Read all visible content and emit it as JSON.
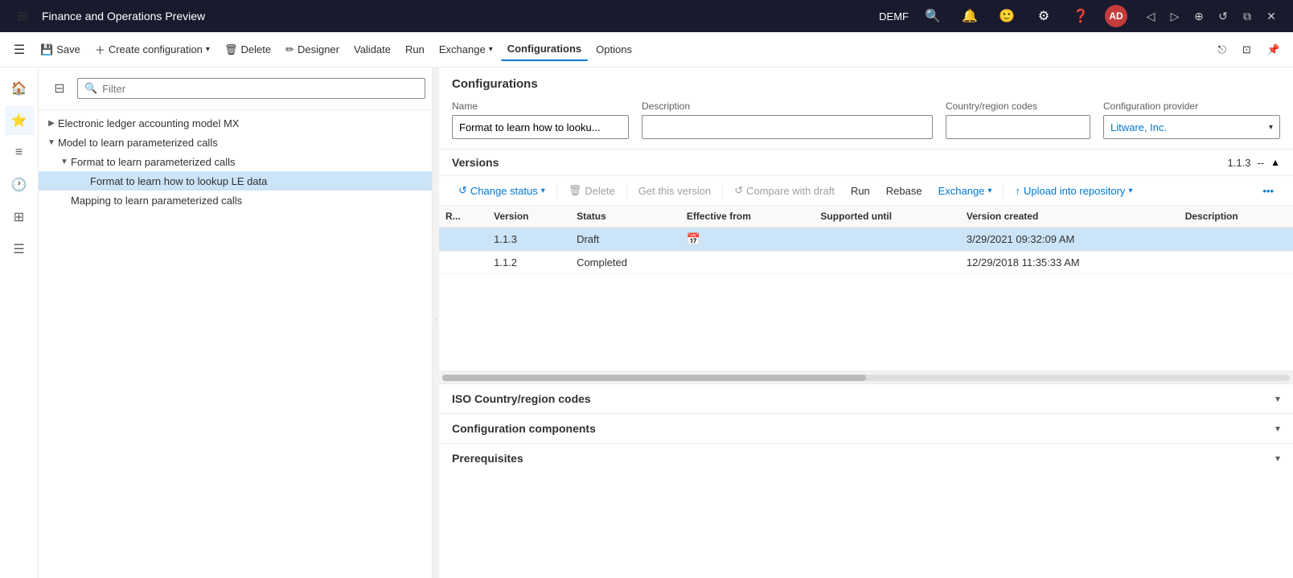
{
  "titlebar": {
    "title": "Finance and Operations Preview",
    "user_label": "DEMF",
    "avatar_initials": "AD"
  },
  "commandbar": {
    "save_label": "Save",
    "create_config_label": "Create configuration",
    "delete_label": "Delete",
    "designer_label": "Designer",
    "validate_label": "Validate",
    "run_label": "Run",
    "exchange_label": "Exchange",
    "configurations_label": "Configurations",
    "options_label": "Options"
  },
  "tree": {
    "filter_placeholder": "Filter",
    "items": [
      {
        "id": "item1",
        "label": "Electronic ledger accounting model MX",
        "indent": 1,
        "expand": "right",
        "selected": false
      },
      {
        "id": "item2",
        "label": "Model to learn parameterized calls",
        "indent": 1,
        "expand": "down",
        "selected": false
      },
      {
        "id": "item3",
        "label": "Format to learn parameterized calls",
        "indent": 2,
        "expand": "down",
        "selected": false
      },
      {
        "id": "item4",
        "label": "Format to learn how to lookup LE data",
        "indent": 3,
        "expand": null,
        "selected": true
      },
      {
        "id": "item5",
        "label": "Mapping to learn parameterized calls",
        "indent": 2,
        "expand": null,
        "selected": false
      }
    ]
  },
  "configurations": {
    "section_title": "Configurations",
    "name_label": "Name",
    "name_value": "Format to learn how to looku...",
    "description_label": "Description",
    "description_value": "",
    "country_label": "Country/region codes",
    "country_value": "",
    "provider_label": "Configuration provider",
    "provider_value": "Litware, Inc."
  },
  "versions": {
    "section_title": "Versions",
    "version_badge": "1.1.3",
    "separator": "--",
    "toolbar": {
      "change_status": "Change status",
      "delete": "Delete",
      "get_this_version": "Get this version",
      "compare_with_draft": "Compare with draft",
      "run": "Run",
      "rebase": "Rebase",
      "exchange": "Exchange",
      "upload_into_repository": "Upload into repository"
    },
    "table": {
      "headers": [
        "R...",
        "Version",
        "Status",
        "Effective from",
        "Supported until",
        "Version created",
        "Description"
      ],
      "rows": [
        {
          "r": "",
          "version": "1.1.3",
          "status": "Draft",
          "effective_from": "",
          "supported_until": "",
          "version_created": "3/29/2021 09:32:09 AM",
          "description": "",
          "selected": true,
          "show_cal": true
        },
        {
          "r": "",
          "version": "1.1.2",
          "status": "Completed",
          "effective_from": "",
          "supported_until": "",
          "version_created": "12/29/2018 11:35:33 AM",
          "description": "",
          "selected": false,
          "show_cal": false
        }
      ]
    }
  },
  "collapsible_sections": [
    {
      "id": "iso",
      "label": "ISO Country/region codes"
    },
    {
      "id": "components",
      "label": "Configuration components"
    },
    {
      "id": "prerequisites",
      "label": "Prerequisites"
    }
  ]
}
